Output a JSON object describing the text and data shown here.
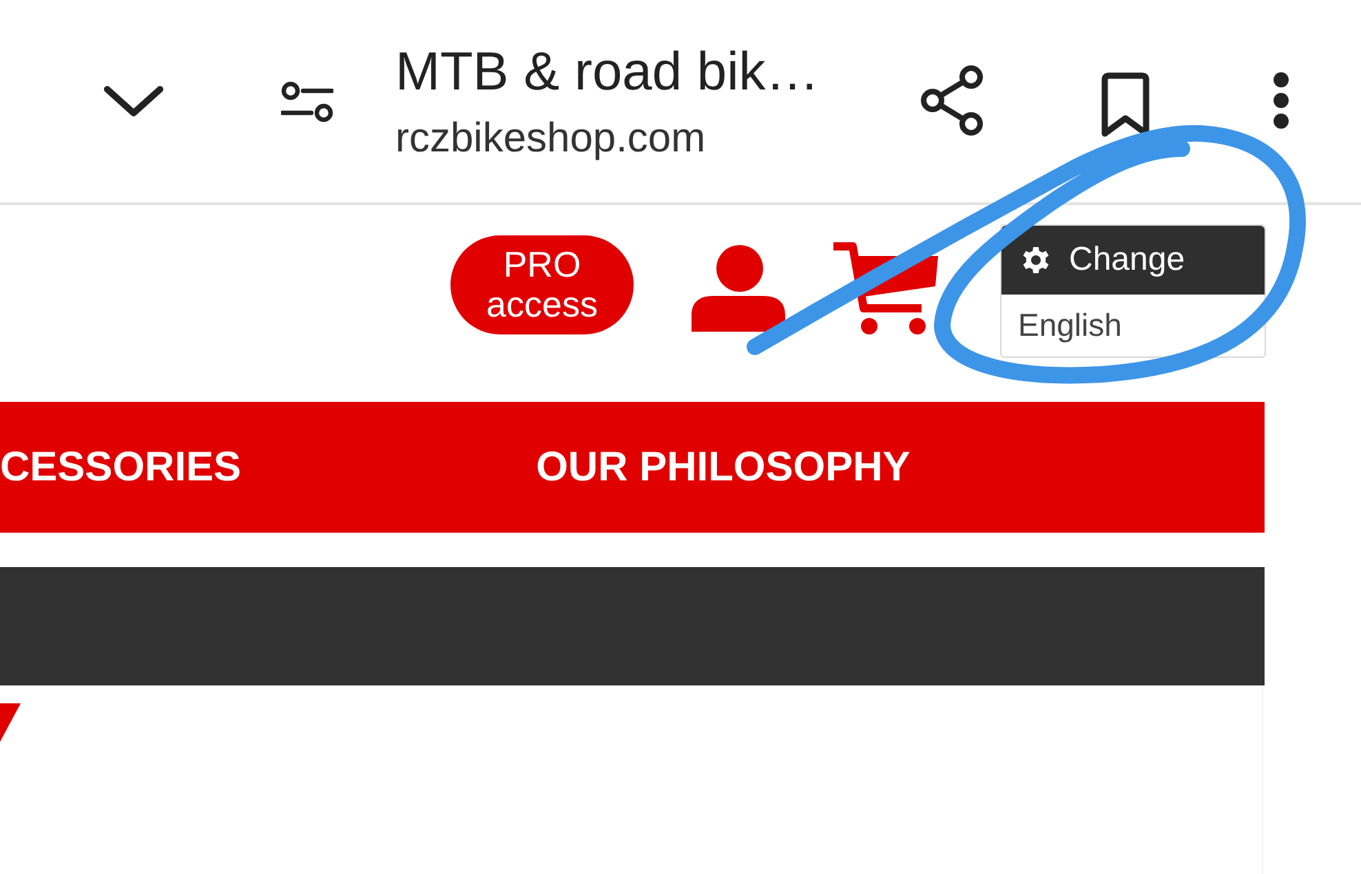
{
  "browser_bar": {
    "title": "MTB & road bik…",
    "url": "rczbikeshop.com"
  },
  "site_header": {
    "pro_button": "PRO access",
    "language_menu": {
      "heading": "Change",
      "current": "English"
    }
  },
  "main_nav": {
    "items": [
      "CESSORIES",
      "OUR PHILOSOPHY"
    ]
  }
}
